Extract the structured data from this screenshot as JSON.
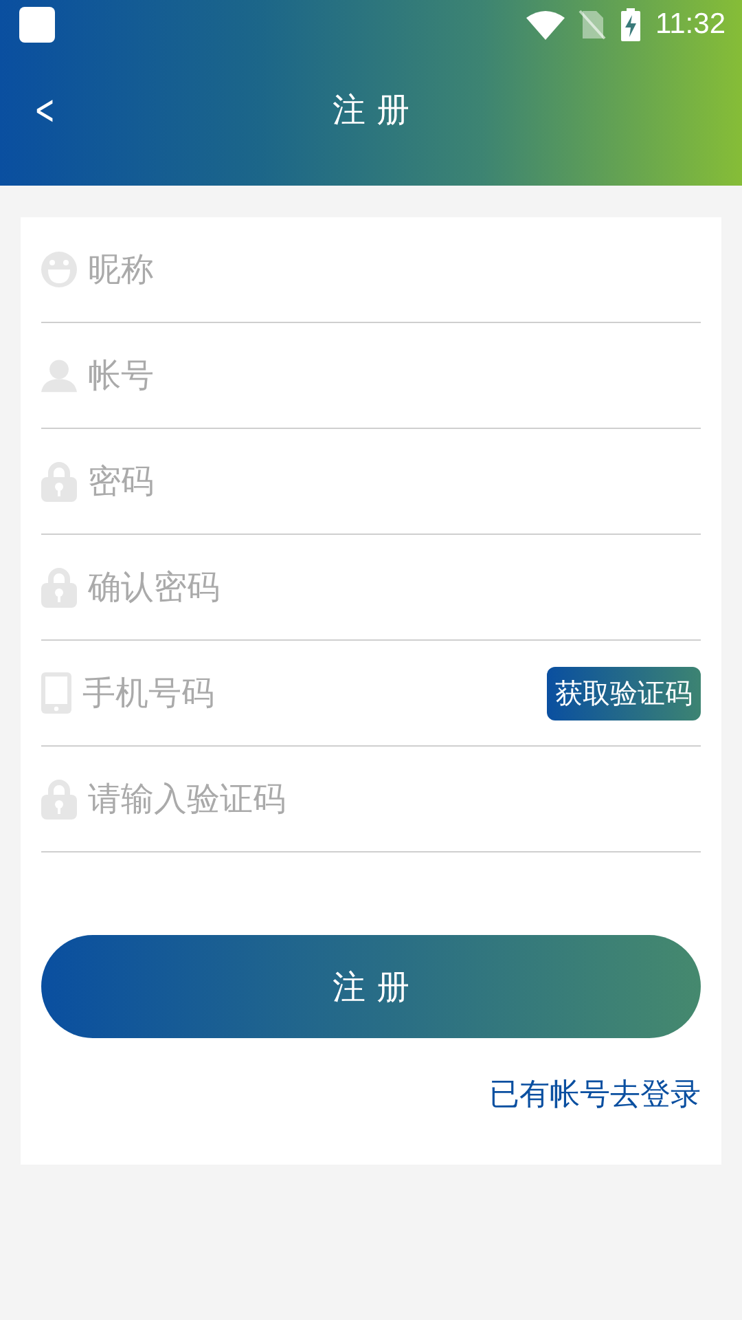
{
  "status_bar": {
    "time": "11:32"
  },
  "header": {
    "back": "<",
    "title": "注 册"
  },
  "fields": [
    {
      "kind": "nickname",
      "placeholder": "昵称"
    },
    {
      "kind": "account",
      "placeholder": "帐号"
    },
    {
      "kind": "password",
      "placeholder": "密码"
    },
    {
      "kind": "password",
      "placeholder": "确认密码"
    },
    {
      "kind": "phone",
      "placeholder": "手机号码",
      "action": "获取验证码"
    },
    {
      "kind": "code",
      "placeholder": "请输入验证码"
    }
  ],
  "submit": "注 册",
  "login_link": "已有帐号去登录"
}
